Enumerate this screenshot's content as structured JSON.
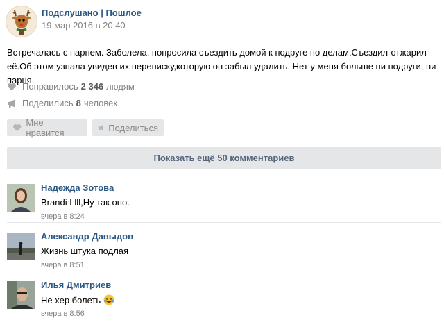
{
  "post": {
    "group_name": "Подслушано | Пошлое",
    "date": "19 мар 2016 в 20:40",
    "text": "Встречалась с парнем. Заболела, попросила съездить домой к подруге по делам.Съездил-отжарил её.Об этом узнала увидев их переписку,которую он забыл удалить. Нет у меня больше ни подруги, ни парня.",
    "likes": {
      "prefix": "Понравилось",
      "count": "2 346",
      "suffix": "людям"
    },
    "shares": {
      "prefix": "Поделились",
      "count": "8",
      "suffix": "человек"
    }
  },
  "actions": {
    "like_label": "Мне нравится",
    "share_label": "Поделиться",
    "show_more": "Показать ещё 50 комментариев"
  },
  "comments": [
    {
      "author": "Надежда Зотова",
      "text": "Brandi Llll,Ну так оно.",
      "time": "вчера в 8:24"
    },
    {
      "author": "Александр Давыдов",
      "text": "Жизнь штука подлая",
      "time": "вчера в 8:51"
    },
    {
      "author": "Илья Дмитриев",
      "text": "Не хер болеть",
      "time": "вчера в 8:56",
      "emoji": "laughing-crying"
    }
  ],
  "colors": {
    "link": "#2a5885",
    "muted": "#828282",
    "button_bg": "#e5e6e7"
  }
}
